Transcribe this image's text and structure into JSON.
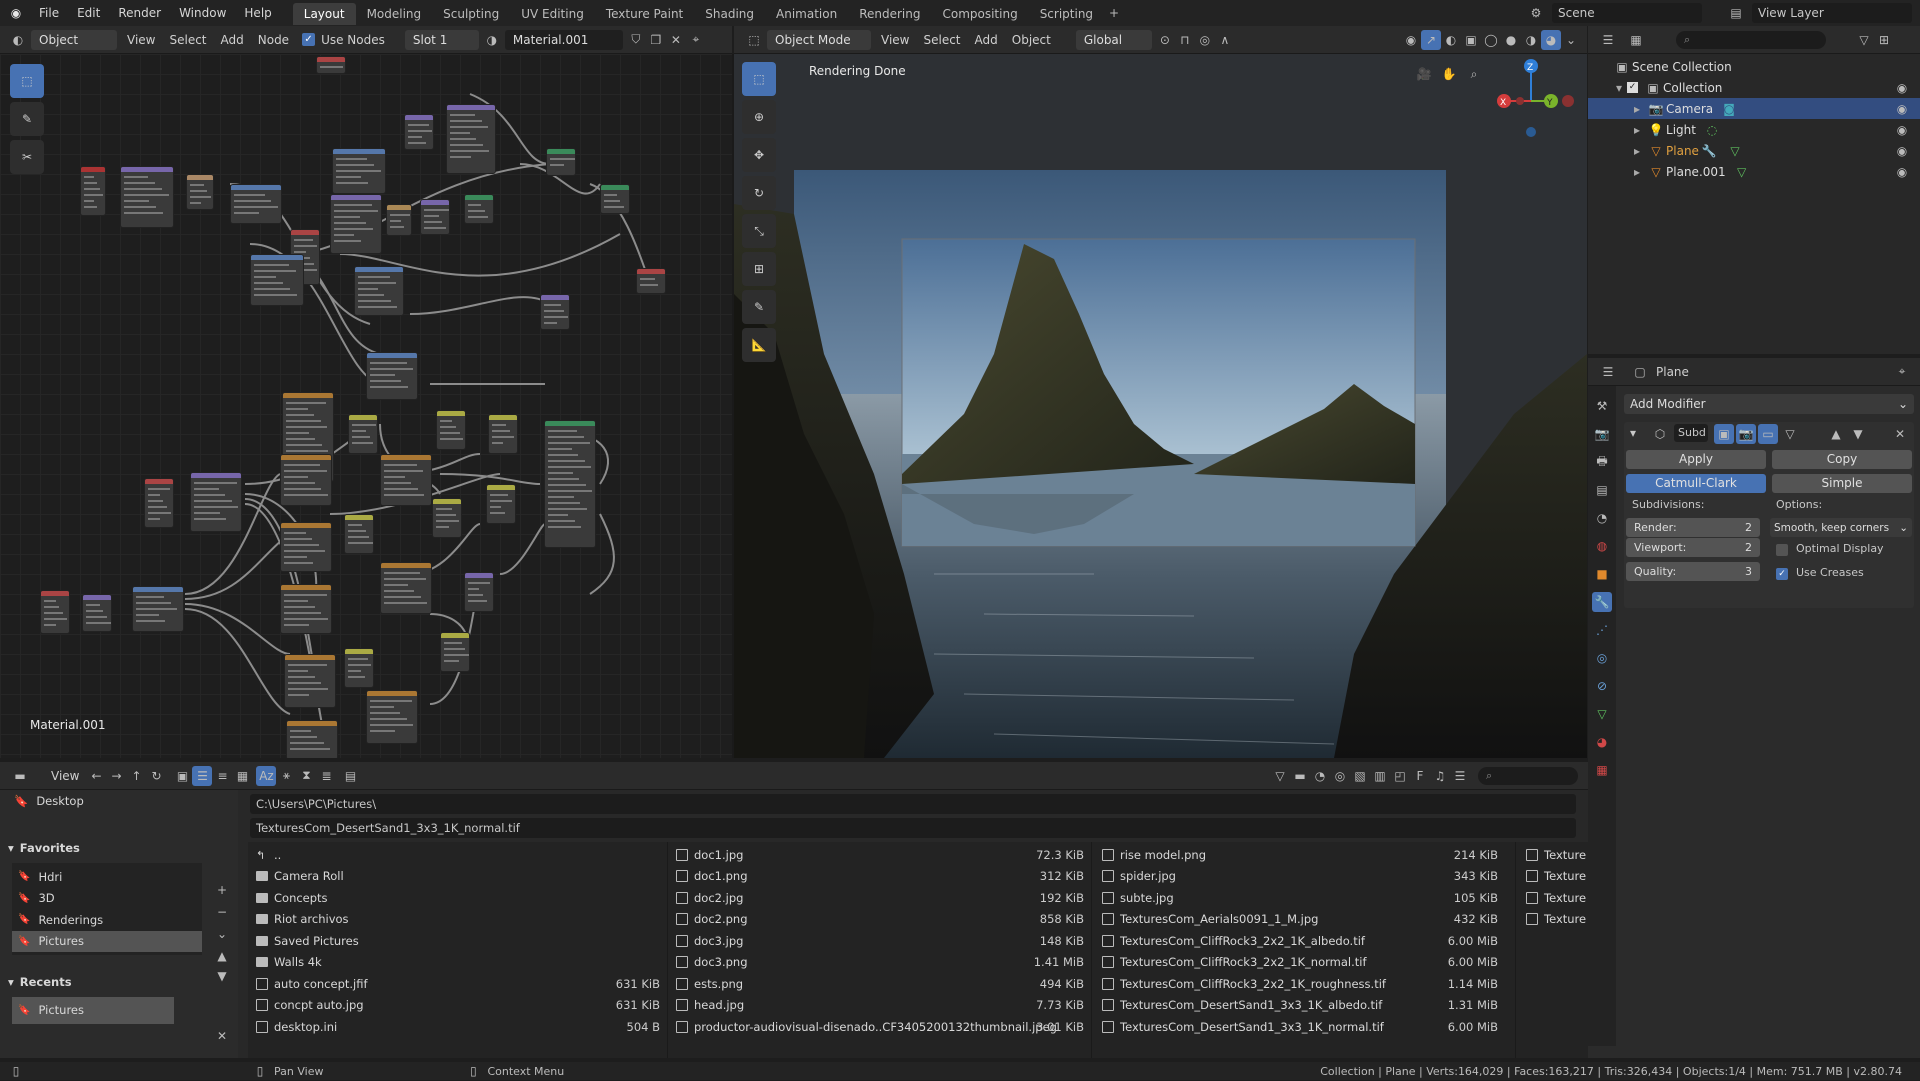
{
  "topbar": {
    "menus": [
      "File",
      "Edit",
      "Render",
      "Window",
      "Help"
    ],
    "workspaces": [
      "Layout",
      "Modeling",
      "Sculpting",
      "UV Editing",
      "Texture Paint",
      "Shading",
      "Animation",
      "Rendering",
      "Compositing",
      "Scripting"
    ],
    "active_workspace": "Layout",
    "scene": "Scene",
    "view_layer": "View Layer"
  },
  "node_editor": {
    "mode": "Object",
    "menus": [
      "View",
      "Select",
      "Add",
      "Node"
    ],
    "use_nodes": "Use Nodes",
    "slot": "Slot 1",
    "material": "Material.001",
    "label": "Material.001"
  },
  "viewport": {
    "mode": "Object Mode",
    "menus": [
      "View",
      "Select",
      "Add",
      "Object"
    ],
    "orientation": "Global",
    "status_text": "Rendering Done",
    "gizmo": {
      "x": "X",
      "y": "Y",
      "z": "Z"
    }
  },
  "outliner": {
    "root": "Scene Collection",
    "collection": "Collection",
    "items": [
      {
        "name": "Camera",
        "selected": true
      },
      {
        "name": "Light",
        "selected": false
      },
      {
        "name": "Plane",
        "selected": false
      },
      {
        "name": "Plane.001",
        "selected": false
      }
    ]
  },
  "properties": {
    "object": "Plane",
    "add_modifier": "Add Modifier",
    "modifier_name": "Subd",
    "apply": "Apply",
    "copy": "Copy",
    "catmull": "Catmull-Clark",
    "simple": "Simple",
    "subdivisions": "Subdivisions:",
    "options": "Options:",
    "render_label": "Render:",
    "render_val": "2",
    "viewport_label": "Viewport:",
    "viewport_val": "2",
    "quality_label": "Quality:",
    "quality_val": "3",
    "uv_smooth": "Smooth, keep corners",
    "optimal_display": "Optimal Display",
    "use_creases": "Use Creases"
  },
  "file_browser": {
    "view": "View",
    "path": "C:\\Users\\PC\\Pictures\\",
    "filename": "TexturesCom_DesertSand1_3x3_1K_normal.tif",
    "system": "Desktop",
    "favorites_title": "Favorites",
    "favorites": [
      "Hdri",
      "3D",
      "Renderings",
      "Pictures"
    ],
    "recents_title": "Recents",
    "recents": [
      "Pictures"
    ],
    "col1": [
      {
        "n": "..",
        "s": "",
        "t": "up"
      },
      {
        "n": "Camera Roll",
        "s": "",
        "t": "folder"
      },
      {
        "n": "Concepts",
        "s": "",
        "t": "folder"
      },
      {
        "n": "Riot archivos",
        "s": "",
        "t": "folder"
      },
      {
        "n": "Saved Pictures",
        "s": "",
        "t": "folder"
      },
      {
        "n": "Walls 4k",
        "s": "",
        "t": "folder"
      },
      {
        "n": "auto concept.jfif",
        "s": "631 KiB",
        "t": "file"
      },
      {
        "n": "concpt auto.jpg",
        "s": "631 KiB",
        "t": "file"
      },
      {
        "n": "desktop.ini",
        "s": "504 B",
        "t": "text"
      }
    ],
    "col2": [
      {
        "n": "doc1.jpg",
        "s": "72.3 KiB"
      },
      {
        "n": "doc1.png",
        "s": "312 KiB"
      },
      {
        "n": "doc2.jpg",
        "s": "192 KiB"
      },
      {
        "n": "doc2.png",
        "s": "858 KiB"
      },
      {
        "n": "doc3.jpg",
        "s": "148 KiB"
      },
      {
        "n": "doc3.png",
        "s": "1.41 MiB"
      },
      {
        "n": "ests.png",
        "s": "494 KiB"
      },
      {
        "n": "head.jpg",
        "s": "7.73 KiB"
      },
      {
        "n": "productor-audiovisual-disenado..CF3405200132thumbnail.jpeg",
        "s": "3.01 KiB"
      }
    ],
    "col3": [
      {
        "n": "rise model.png",
        "s": "214 KiB"
      },
      {
        "n": "spider.jpg",
        "s": "343 KiB"
      },
      {
        "n": "subte.jpg",
        "s": "105 KiB"
      },
      {
        "n": "TexturesCom_Aerials0091_1_M.jpg",
        "s": "432 KiB"
      },
      {
        "n": "TexturesCom_CliffRock3_2x2_1K_albedo.tif",
        "s": "6.00 MiB"
      },
      {
        "n": "TexturesCom_CliffRock3_2x2_1K_normal.tif",
        "s": "6.00 MiB"
      },
      {
        "n": "TexturesCom_CliffRock3_2x2_1K_roughness.tif",
        "s": "1.14 MiB"
      },
      {
        "n": "TexturesCom_DesertSand1_3x3_1K_albedo.tif",
        "s": "1.31 MiB"
      },
      {
        "n": "TexturesCom_DesertSand1_3x3_1K_normal.tif",
        "s": "6.00 MiB"
      }
    ],
    "col4": [
      "Texture",
      "Texture",
      "Texture",
      "Texture"
    ]
  },
  "statusbar": {
    "pan": "Pan View",
    "context": "Context Menu",
    "stats": "Collection | Plane | Verts:164,029 | Faces:163,217 | Tris:326,434 | Objects:1/4 | Mem: 751.7 MB | v2.80.74"
  },
  "colors": {
    "accent": "#4772b3",
    "selected_row": "#334d80",
    "orange": "#e0892c"
  }
}
